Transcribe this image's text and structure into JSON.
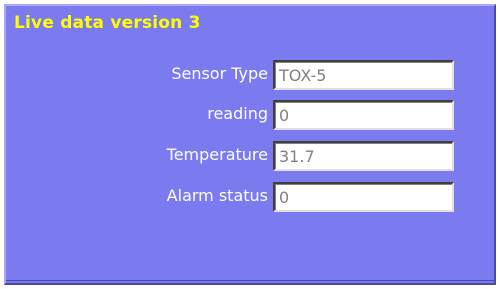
{
  "panel": {
    "title": "Live data version 3"
  },
  "fields": [
    {
      "label": "Sensor Type",
      "value": "TOX-5"
    },
    {
      "label": "reading",
      "value": "0"
    },
    {
      "label": "Temperature",
      "value": "31.7"
    },
    {
      "label": "Alarm status",
      "value": "0"
    }
  ],
  "colors": {
    "panel_background": "#7b7bef",
    "title": "#ffff00",
    "label": "#ffffff",
    "field_text": "#808080"
  }
}
